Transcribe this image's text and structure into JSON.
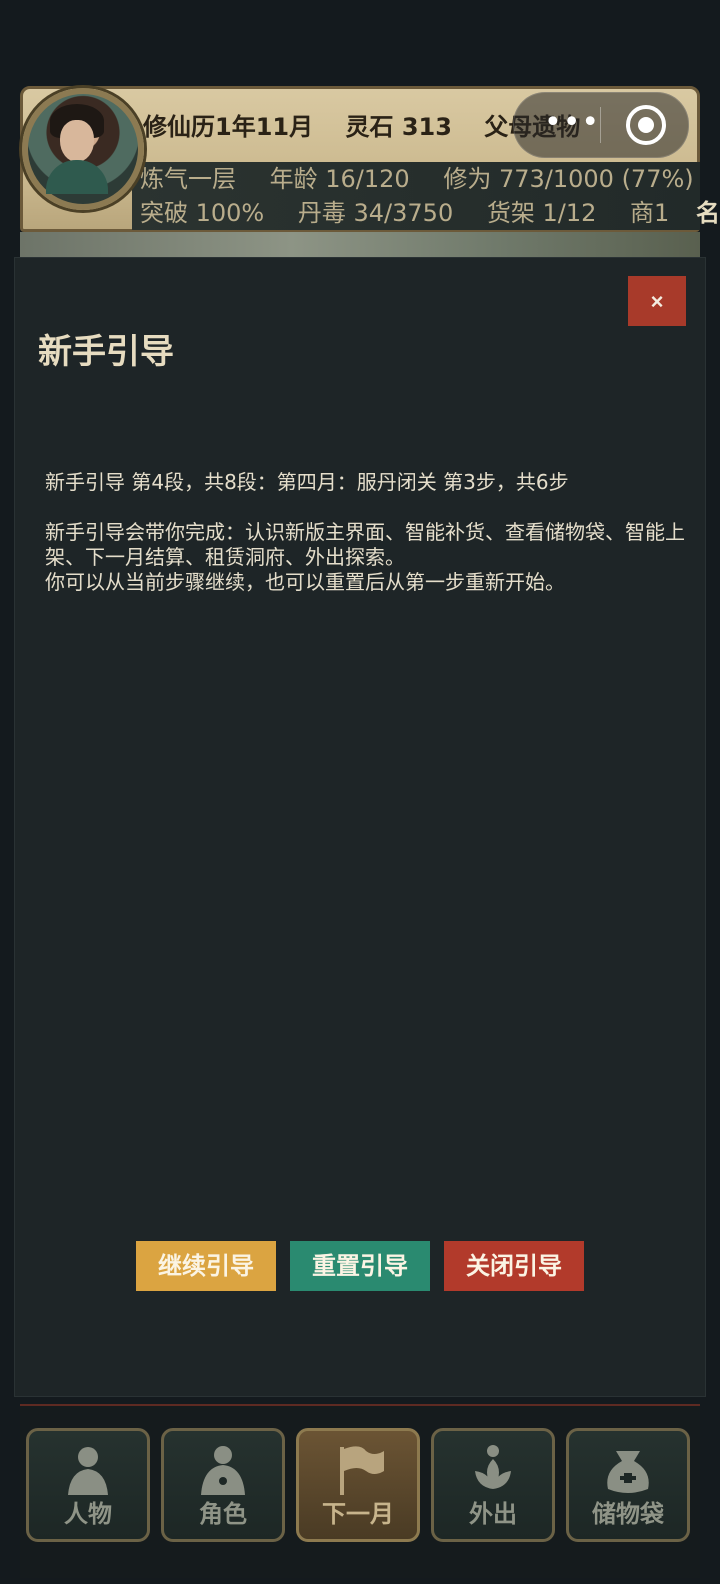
{
  "header": {
    "calendar": "修仙历1年11月",
    "spirit_stone": "灵石 313",
    "event": "父母遗物",
    "realm": "炼气一层",
    "age": "年龄 16/120",
    "cultivation": "修为 773/1000 (77%)",
    "breakthrough": "突破 100%",
    "pill_toxicity": "丹毒 34/3750",
    "shelf": "货架 1/12",
    "merchant": "商1",
    "overflow": "名"
  },
  "capsule": {
    "more_icon": "more-dots-icon",
    "close_icon": "target-icon"
  },
  "modal": {
    "title": "新手引导",
    "close_label": "×",
    "progress": "新手引导 第4段，共8段：第四月：服丹闭关 第3步，共6步",
    "description": "新手引导会带你完成：认识新版主界面、智能补货、查看储物袋、智能上架、下一月结算、租赁洞府、外出探索。",
    "hint": "你可以从当前步骤继续，也可以重置后从第一步重新开始。",
    "buttons": {
      "continue": "继续引导",
      "reset": "重置引导",
      "close": "关闭引导"
    },
    "colors": {
      "continue": "#dba441",
      "reset": "#2a8a70",
      "close": "#b23a2b"
    }
  },
  "bottom_nav": [
    {
      "label": "人物",
      "icon": "person-icon"
    },
    {
      "label": "角色",
      "icon": "character-icon"
    },
    {
      "label": "下一月",
      "icon": "flag-icon"
    },
    {
      "label": "外出",
      "icon": "lotus-icon"
    },
    {
      "label": "储物袋",
      "icon": "bag-icon"
    }
  ]
}
